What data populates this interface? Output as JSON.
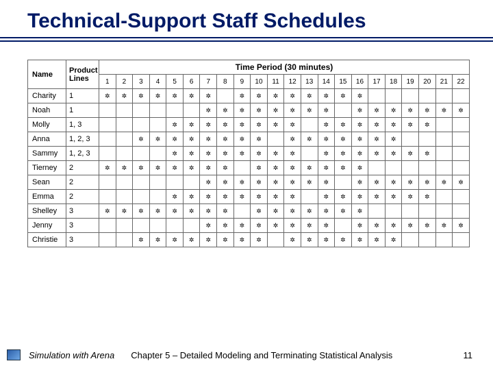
{
  "title": "Technical-Support Staff Schedules",
  "headers": {
    "name": "Name",
    "lines": "Product Lines",
    "period": "Time Period (30 minutes)"
  },
  "periods": [
    "1",
    "2",
    "3",
    "4",
    "5",
    "6",
    "7",
    "8",
    "9",
    "10",
    "11",
    "12",
    "13",
    "14",
    "15",
    "16",
    "17",
    "18",
    "19",
    "20",
    "21",
    "22"
  ],
  "chart_data": {
    "type": "table",
    "title": "Technical-Support Staff Schedules",
    "columns": [
      "Name",
      "Product Lines",
      "1",
      "2",
      "3",
      "4",
      "5",
      "6",
      "7",
      "8",
      "9",
      "10",
      "11",
      "12",
      "13",
      "14",
      "15",
      "16",
      "17",
      "18",
      "19",
      "20",
      "21",
      "22"
    ],
    "rows": [
      {
        "name": "Charity",
        "lines": "1",
        "slots": [
          1,
          1,
          1,
          1,
          1,
          1,
          1,
          0,
          1,
          1,
          1,
          1,
          1,
          1,
          1,
          1,
          0,
          0,
          0,
          0,
          0,
          0
        ]
      },
      {
        "name": "Noah",
        "lines": "1",
        "slots": [
          0,
          0,
          0,
          0,
          0,
          0,
          1,
          1,
          1,
          1,
          1,
          1,
          1,
          1,
          0,
          1,
          1,
          1,
          1,
          1,
          1,
          1
        ]
      },
      {
        "name": "Molly",
        "lines": "1, 3",
        "slots": [
          0,
          0,
          0,
          0,
          1,
          1,
          1,
          1,
          1,
          1,
          1,
          1,
          0,
          1,
          1,
          1,
          1,
          1,
          1,
          1,
          0,
          0
        ]
      },
      {
        "name": "Anna",
        "lines": "1, 2, 3",
        "slots": [
          0,
          0,
          1,
          1,
          1,
          1,
          1,
          1,
          1,
          1,
          0,
          1,
          1,
          1,
          1,
          1,
          1,
          1,
          0,
          0,
          0,
          0
        ]
      },
      {
        "name": "Sammy",
        "lines": "1, 2, 3",
        "slots": [
          0,
          0,
          0,
          0,
          1,
          1,
          1,
          1,
          1,
          1,
          1,
          1,
          0,
          1,
          1,
          1,
          1,
          1,
          1,
          1,
          0,
          0
        ]
      },
      {
        "name": "Tierney",
        "lines": "2",
        "slots": [
          1,
          1,
          1,
          1,
          1,
          1,
          1,
          1,
          0,
          1,
          1,
          1,
          1,
          1,
          1,
          1,
          0,
          0,
          0,
          0,
          0,
          0
        ]
      },
      {
        "name": "Sean",
        "lines": "2",
        "slots": [
          0,
          0,
          0,
          0,
          0,
          0,
          1,
          1,
          1,
          1,
          1,
          1,
          1,
          1,
          0,
          1,
          1,
          1,
          1,
          1,
          1,
          1
        ]
      },
      {
        "name": "Emma",
        "lines": "2",
        "slots": [
          0,
          0,
          0,
          0,
          1,
          1,
          1,
          1,
          1,
          1,
          1,
          1,
          0,
          1,
          1,
          1,
          1,
          1,
          1,
          1,
          0,
          0
        ]
      },
      {
        "name": "Shelley",
        "lines": "3",
        "slots": [
          1,
          1,
          1,
          1,
          1,
          1,
          1,
          1,
          0,
          1,
          1,
          1,
          1,
          1,
          1,
          1,
          0,
          0,
          0,
          0,
          0,
          0
        ]
      },
      {
        "name": "Jenny",
        "lines": "3",
        "slots": [
          0,
          0,
          0,
          0,
          0,
          0,
          1,
          1,
          1,
          1,
          1,
          1,
          1,
          1,
          0,
          1,
          1,
          1,
          1,
          1,
          1,
          1
        ]
      },
      {
        "name": "Christie",
        "lines": "3",
        "slots": [
          0,
          0,
          1,
          1,
          1,
          1,
          1,
          1,
          1,
          1,
          0,
          1,
          1,
          1,
          1,
          1,
          1,
          1,
          0,
          0,
          0,
          0
        ]
      }
    ]
  },
  "footer": {
    "book": "Simulation with Arena",
    "chapter": "Chapter 5 – Detailed Modeling and Terminating Statistical Analysis",
    "page": "11"
  }
}
